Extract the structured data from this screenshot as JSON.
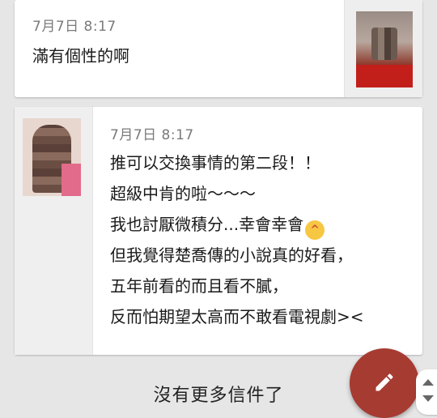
{
  "messages": [
    {
      "timestamp": "7月7日 8:17",
      "lines": [
        "滿有個性的啊"
      ]
    },
    {
      "timestamp": "7月7日 8:17",
      "lines": [
        "推可以交換事情的第二段！！",
        "超級中肯的啦～～～",
        "我也討厭微積分...幸會幸會",
        "但我覺得楚喬傳的小說真的好看，",
        "五年前看的而且看不膩，",
        "反而怕期望太高而不敢看電視劇><"
      ],
      "emoji_after_line": 2,
      "emoji": "laughing-face"
    }
  ],
  "footer": {
    "no_more_text": "沒有更多信件了"
  },
  "fab": {
    "icon": "pencil-icon",
    "color": "#a63b32"
  }
}
